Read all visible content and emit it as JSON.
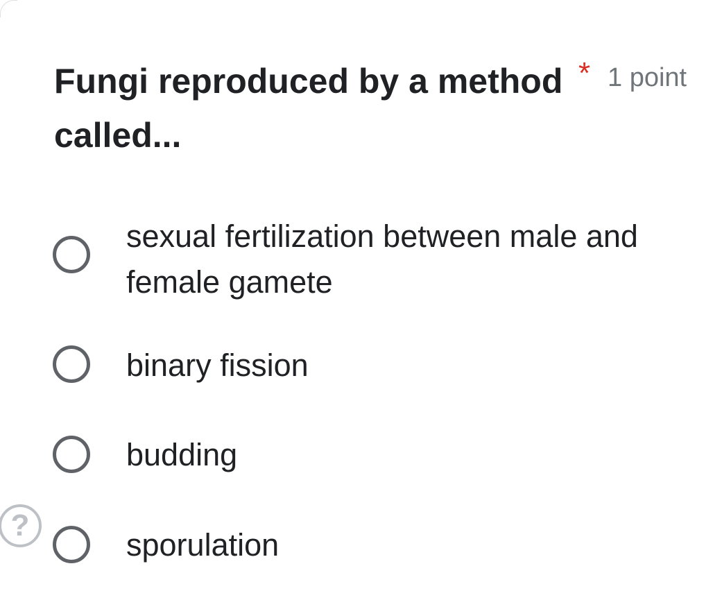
{
  "question": {
    "title": "Fungi reproduced by a method called...",
    "required_marker": "*",
    "points": "1 point"
  },
  "options": [
    {
      "label": "sexual fertilization between male and female gamete",
      "selected": false
    },
    {
      "label": "binary fission",
      "selected": false
    },
    {
      "label": "budding",
      "selected": false
    },
    {
      "label": "sporulation",
      "selected": false
    }
  ],
  "help": {
    "icon": "help-icon",
    "glyph": "?"
  },
  "colors": {
    "required": "#d93025",
    "points": "#70757a",
    "radio_border": "#5f6368",
    "help_icon": "#bdc1c6"
  }
}
